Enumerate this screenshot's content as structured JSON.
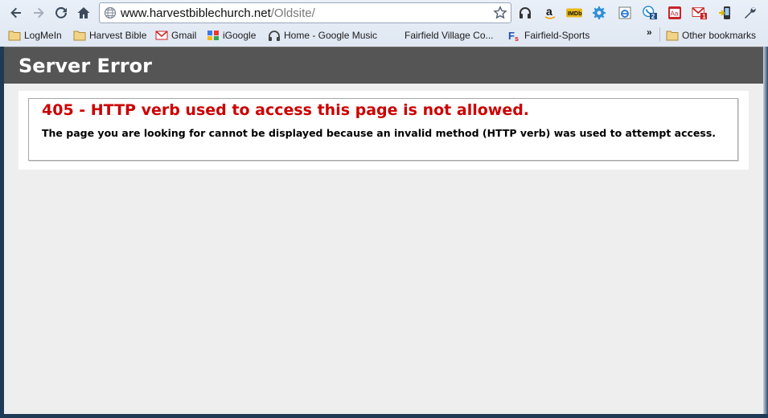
{
  "browser": {
    "url_host": "www.harvestbiblechurch.net",
    "url_path": "/Oldsite/",
    "bookmarks": [
      {
        "label": "LogMeIn",
        "icon": "folder-icon"
      },
      {
        "label": "Harvest Bible",
        "icon": "folder-icon"
      },
      {
        "label": "Gmail",
        "icon": "gmail-icon"
      },
      {
        "label": "iGoogle",
        "icon": "igoogle-icon"
      },
      {
        "label": "Home - Google Music",
        "icon": "headphones-icon"
      },
      {
        "label": "Fairfield Village Co...",
        "icon": ""
      },
      {
        "label": "Fairfield-Sports",
        "icon": "fs-icon"
      }
    ],
    "chevron": "»",
    "other_bookmarks": "Other bookmarks",
    "extensions": [
      "headphones-icon",
      "amazon-icon",
      "imdb-icon",
      "gear-icon",
      "ie-tab-icon",
      "skype-icon",
      "dictionary-icon",
      "gmail-notifier-icon",
      "phone-icon",
      "wrench-icon"
    ],
    "badges": {
      "skype": "2",
      "gmail": "1",
      "imdb": "IMDb",
      "dictionary": "Aa",
      "amazon": "a"
    },
    "colors": {
      "frame": "#1e3a55",
      "toolbar": "#dfe7f2"
    }
  },
  "page": {
    "header_title": "Server Error",
    "error_title": "405 - HTTP verb used to access this page is not allowed.",
    "error_message": "The page you are looking for cannot be displayed because an invalid method (HTTP verb) was used to attempt access.",
    "colors": {
      "header_bg": "#555555",
      "error_red": "#cc0000",
      "page_bg": "#eeeeee"
    }
  }
}
